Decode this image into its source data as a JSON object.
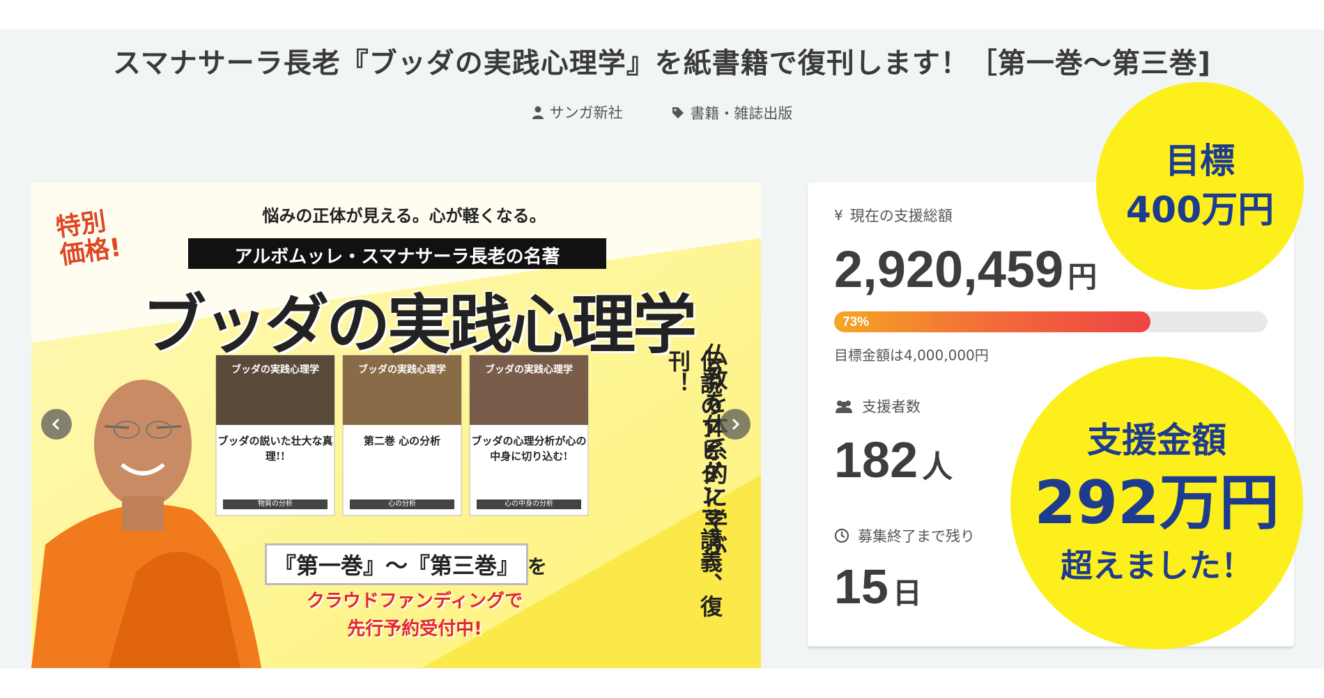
{
  "project": {
    "title": "スマナサーラ長老『ブッダの実践心理学』を紙書籍で復刊します！［第一巻〜第三巻]",
    "owner": "サンガ新社",
    "category": "書籍・雑誌出版"
  },
  "hero": {
    "corner_badge_line1": "特別",
    "corner_badge_line2": "価格!",
    "tagline": "悩みの正体が見える。心が軽くなる。",
    "author_banner": "アルボムッレ・スマナサーラ長老の名著",
    "main_title": "ブッダの実践心理学",
    "side_copy_1": "仏教を体系的に学ぶ",
    "side_copy_2": "伝説のアビダンマ講義、復刊！",
    "volumes_label": "『第一巻』〜『第三巻』",
    "volumes_suffix": "を",
    "cta_line1": "クラウドファンディングで",
    "cta_line2": "先行予約受付中!",
    "books": [
      {
        "title": "ブッダの実践心理学",
        "headline": "ブッダの説いた壮大な真理!!",
        "footer": "物質の分析"
      },
      {
        "title": "ブッダの実践心理学",
        "headline": "第二巻 心の分析",
        "footer": "心の分析"
      },
      {
        "title": "ブッダの実践心理学",
        "headline": "ブッダの心理分析が心の中身に切り込む!",
        "footer": "心の中身の分析"
      }
    ]
  },
  "stats": {
    "current_label": "現在の支援総額",
    "current_value": "2,920,459",
    "currency_unit": "円",
    "progress_percent": 73,
    "progress_label": "73%",
    "goal_note": "目標金額は4,000,000円",
    "backers_label": "支援者数",
    "backers_value": "182",
    "backers_unit": "人",
    "remaining_label": "募集終了まで残り",
    "remaining_value": "15",
    "remaining_unit": "日"
  },
  "overlays": {
    "goal_line1": "目標",
    "goal_line2": "400万円",
    "raised_line1": "支援金額",
    "raised_line2": "292万円",
    "raised_line3": "超えました！"
  },
  "colors": {
    "badge_yellow": "#fcef1b",
    "badge_text": "#1d3b8f",
    "robe_orange": "#f07a1c",
    "progress_start": "#f5a623",
    "progress_end": "#ee4444"
  }
}
